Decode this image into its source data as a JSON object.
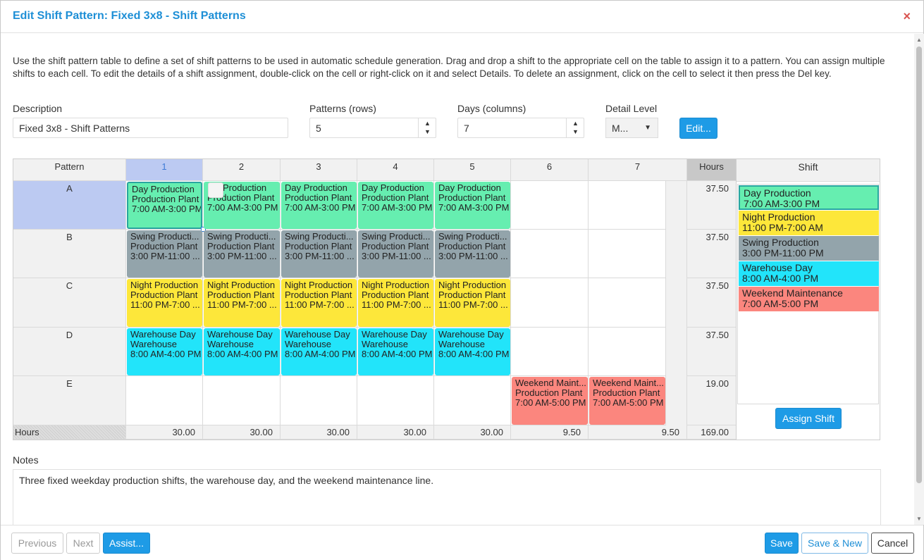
{
  "dialog": {
    "title": "Edit Shift Pattern: Fixed 3x8 - Shift Patterns",
    "close_glyph": "×"
  },
  "intro": "Use the shift pattern table to define a set of shift patterns to be used in automatic schedule generation. Drag and drop a shift to the appropriate cell on the table to assign it to a pattern. You can assign multiple shifts to each cell. To edit the details of a shift assignment, double-click on the cell or right-click on it and select Details. To delete an assignment, click on the cell to select it then press the Del key.",
  "form": {
    "description_label": "Description",
    "description_value": "Fixed 3x8 - Shift Patterns",
    "patterns_label": "Patterns (rows)",
    "patterns_value": "5",
    "days_label": "Days (columns)",
    "days_value": "7",
    "detail_label": "Detail Level",
    "detail_value": "M...",
    "edit_button": "Edit..."
  },
  "grid": {
    "pattern_header": "Pattern",
    "hours_header": "Hours",
    "footer_label": "Hours",
    "days": [
      "1",
      "2",
      "3",
      "4",
      "5",
      "6",
      "7"
    ],
    "rows": [
      {
        "label": "A",
        "hours": "37.50"
      },
      {
        "label": "B",
        "hours": "37.50"
      },
      {
        "label": "C",
        "hours": "37.50"
      },
      {
        "label": "D",
        "hours": "37.50"
      },
      {
        "label": "E",
        "hours": "19.00"
      }
    ],
    "day_totals": [
      "30.00",
      "30.00",
      "30.00",
      "30.00",
      "30.00",
      "9.50",
      "9.50"
    ],
    "grand_total": "169.00",
    "assignments": {
      "A": {
        "line1": "Day Production",
        "line2": "Production Plant",
        "line3": "7:00 AM-3:00 PM",
        "color": "#66eeb0"
      },
      "A2": {
        "line1": "Production",
        "line2": "Production Plant",
        "line3": "7:00 AM-3:00 PM",
        "color": "#66eeb0"
      },
      "B": {
        "line1": "Swing Producti...",
        "line2": "Production Plant",
        "line3": "3:00 PM-11:00 ...",
        "color": "#93a4ab"
      },
      "C": {
        "line1": "Night Production",
        "line2": "Production Plant",
        "line3": "11:00 PM-7:00 ...",
        "color": "#fde73a"
      },
      "D": {
        "line1": "Warehouse Day",
        "line2": "Warehouse",
        "line3": "8:00 AM-4:00 PM",
        "color": "#22e4fa"
      },
      "E": {
        "line1": "Weekend Maint...",
        "line2": "Production Plant",
        "line3": "7:00 AM-5:00 PM",
        "color": "#fb867e"
      }
    }
  },
  "shift_panel": {
    "header": "Shift",
    "items": [
      {
        "name": "Day Production",
        "time": "7:00 AM-3:00 PM",
        "color": "#66eeb0"
      },
      {
        "name": "Night Production",
        "time": "11:00 PM-7:00 AM",
        "color": "#fde73a"
      },
      {
        "name": "Swing Production",
        "time": "3:00 PM-11:00 PM",
        "color": "#93a4ab"
      },
      {
        "name": "Warehouse Day",
        "time": "8:00 AM-4:00 PM",
        "color": "#22e4fa"
      },
      {
        "name": "Weekend Maintenance",
        "time": "7:00 AM-5:00 PM",
        "color": "#fb867e"
      }
    ],
    "assign_button": "Assign Shift"
  },
  "notes": {
    "label": "Notes",
    "value": "Three fixed weekday production shifts, the warehouse day, and the weekend maintenance line."
  },
  "footer": {
    "previous": "Previous",
    "next": "Next",
    "assist": "Assist...",
    "save": "Save",
    "save_new": "Save & New",
    "cancel": "Cancel"
  }
}
